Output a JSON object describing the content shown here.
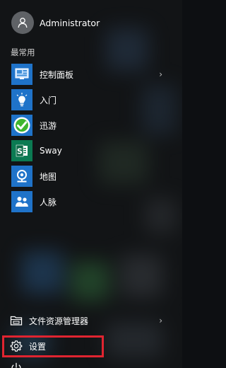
{
  "user": {
    "name": "Administrator"
  },
  "section": {
    "most_used": "最常用"
  },
  "apps": [
    {
      "label": "控制面板",
      "icon": "control-panel-icon",
      "tile_color": "#1f73c9",
      "has_submenu": true
    },
    {
      "label": "入门",
      "icon": "lightbulb-icon",
      "tile_color": "#1f73c9",
      "has_submenu": false
    },
    {
      "label": "迅游",
      "icon": "xunyou-logo-icon",
      "tile_color": "#1f73c9",
      "has_submenu": false
    },
    {
      "label": "Sway",
      "icon": "sway-icon",
      "tile_color": "#0b7a52",
      "has_submenu": false
    },
    {
      "label": "地图",
      "icon": "maps-icon",
      "tile_color": "#1f73c9",
      "has_submenu": false
    },
    {
      "label": "人脉",
      "icon": "people-icon",
      "tile_color": "#1f73c9",
      "has_submenu": false
    }
  ],
  "bottom": {
    "file_explorer": "文件资源管理器",
    "settings": "设置"
  },
  "chevron_glyph": "›",
  "colors": {
    "highlight": "#e02430",
    "panel_bg": "#121416"
  }
}
